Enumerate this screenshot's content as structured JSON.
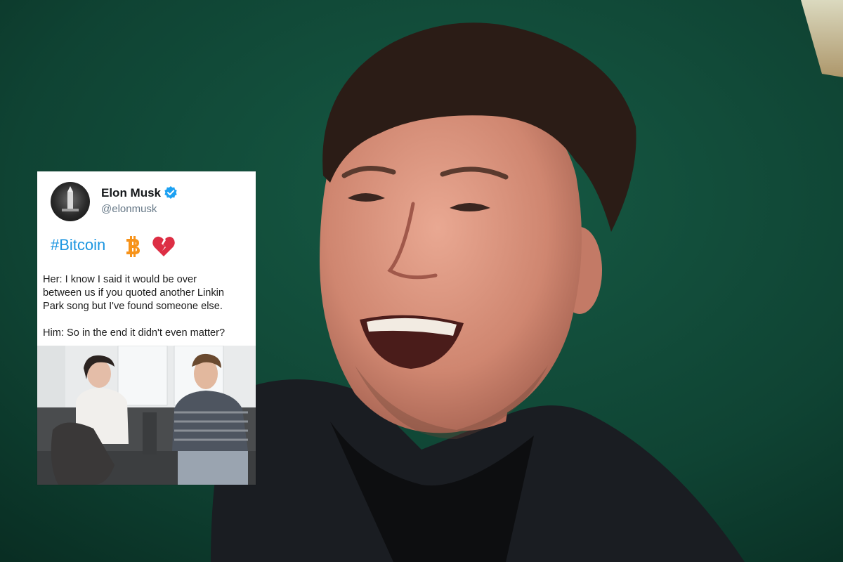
{
  "tweet": {
    "display_name": "Elon Musk",
    "handle": "@elonmusk",
    "hashtag": "#Bitcoin",
    "icons": [
      "verified-badge-icon",
      "bitcoin-icon",
      "broken-heart-icon"
    ],
    "meme_lines": [
      "Her: I know I said it would be over",
      "between us if you quoted another Linkin",
      "Park song but I've found someone else.",
      "Him: So in the end it didn't even matter?"
    ]
  },
  "colors": {
    "background": "#0c3a2c",
    "handle": "#657786",
    "hashtag": "#1b95e0",
    "verified": "#1da1f2",
    "bitcoin": "#f7931a",
    "heart": "#dd2e44"
  }
}
